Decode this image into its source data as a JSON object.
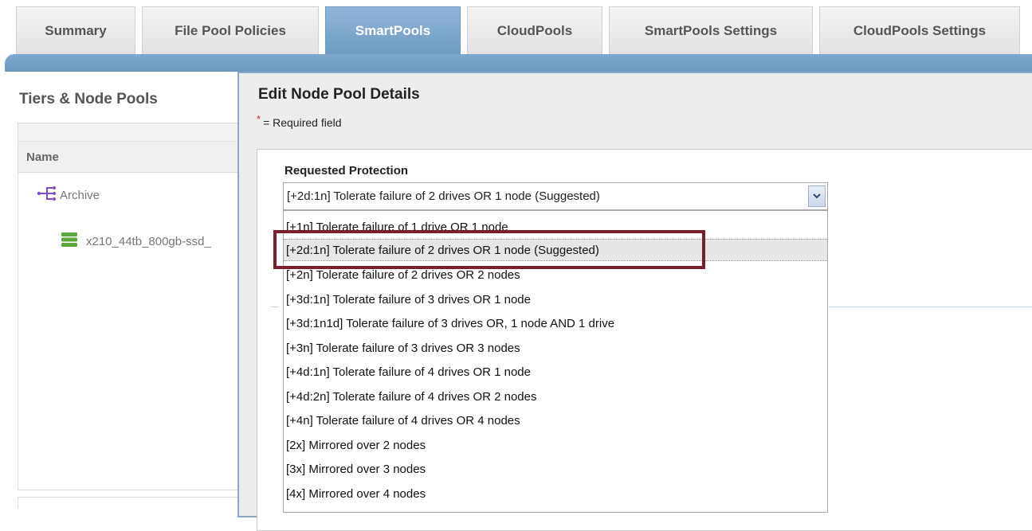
{
  "tabs": [
    {
      "label": "Summary",
      "active": false
    },
    {
      "label": "File Pool Policies",
      "active": false
    },
    {
      "label": "SmartPools",
      "active": true
    },
    {
      "label": "CloudPools",
      "active": false
    },
    {
      "label": "SmartPools Settings",
      "active": false
    },
    {
      "label": "CloudPools Settings",
      "active": false
    }
  ],
  "left": {
    "title": "Tiers & Node Pools",
    "column_header": "Name",
    "tree": [
      {
        "label": "Archive",
        "icon": "tier-icon"
      },
      {
        "label": "x210_44tb_800gb-ssd_",
        "icon": "node-pool-icon"
      }
    ]
  },
  "modal": {
    "title": "Edit Node Pool Details",
    "required_star": "*",
    "required_note": "= Required field",
    "field_label": "Requested Protection",
    "selected_value": "[+2d:1n] Tolerate failure of 2 drives OR 1 node (Suggested)",
    "options": [
      "[+1n] Tolerate failure of 1 drive OR 1 node",
      "[+2d:1n] Tolerate failure of 2 drives OR 1 node (Suggested)",
      "[+2n] Tolerate failure of 2 drives OR 2 nodes",
      "[+3d:1n] Tolerate failure of 3 drives OR 1 node",
      "[+3d:1n1d] Tolerate failure of 3 drives OR, 1 node AND 1 drive",
      "[+3n] Tolerate failure of 3 drives OR 3 nodes",
      "[+4d:1n] Tolerate failure of 4 drives OR 1 node",
      "[+4d:2n] Tolerate failure of 4 drives OR 2 nodes",
      "[+4n] Tolerate failure of 4 drives OR 4 nodes",
      "[2x] Mirrored over 2 nodes",
      "[3x] Mirrored over 3 nodes",
      "[4x] Mirrored over 4 nodes"
    ],
    "highlighted_index": 1
  },
  "colors": {
    "accent": "#6e9cc4",
    "highlight_border": "#7d1f2a",
    "tree_icon": "#7b4fc9",
    "pool_icon": "#5aa83a"
  }
}
